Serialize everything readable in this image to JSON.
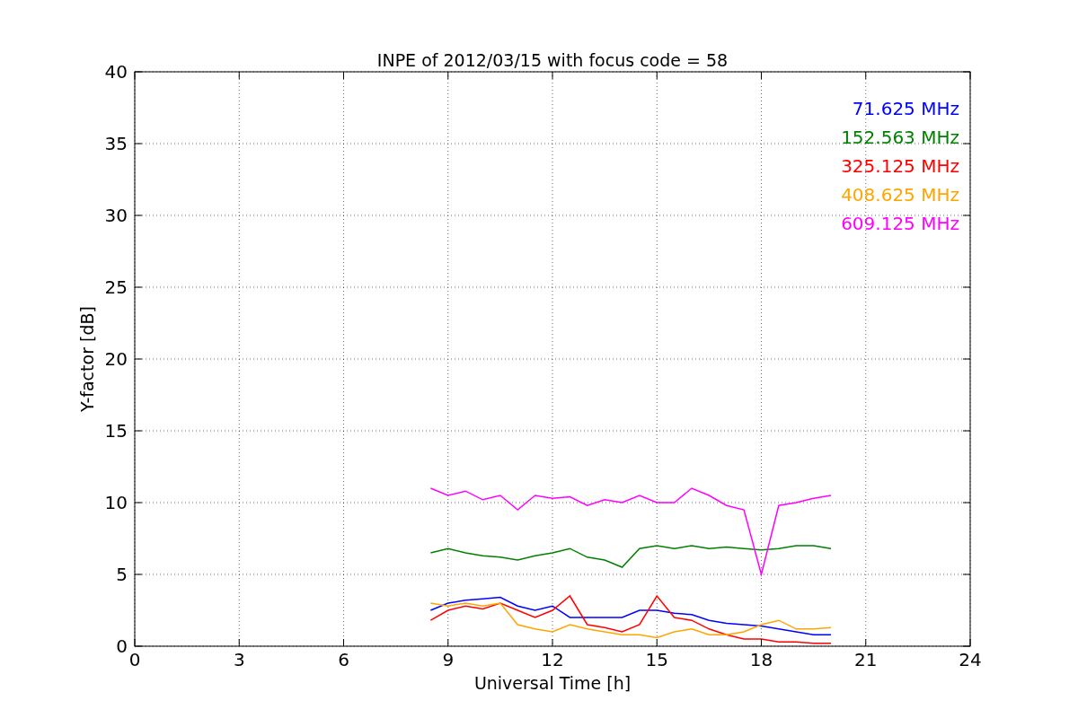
{
  "chart_data": {
    "type": "line",
    "title": "INPE of 2012/03/15 with focus code = 58",
    "xlabel": "Universal Time [h]",
    "ylabel": "Y-factor [dB]",
    "x": [
      8.5,
      9,
      9.5,
      10,
      10.5,
      11,
      11.5,
      12,
      12.5,
      13,
      13.5,
      14,
      14.5,
      15,
      15.5,
      16,
      16.5,
      17,
      17.5,
      18,
      18.5,
      19,
      19.5,
      20
    ],
    "series": [
      {
        "name": "71.625 MHz",
        "color": "#0000ff",
        "values": [
          2.5,
          3.0,
          3.2,
          3.3,
          3.4,
          2.8,
          2.5,
          2.8,
          2.0,
          2.0,
          2.0,
          2.0,
          2.5,
          2.5,
          2.3,
          2.2,
          1.8,
          1.6,
          1.5,
          1.4,
          1.2,
          1.0,
          0.8,
          0.8
        ]
      },
      {
        "name": "152.563 MHz",
        "color": "#008000",
        "values": [
          6.5,
          6.8,
          6.5,
          6.3,
          6.2,
          6.0,
          6.3,
          6.5,
          6.8,
          6.2,
          6.0,
          5.5,
          6.8,
          7.0,
          6.8,
          7.0,
          6.8,
          6.9,
          6.8,
          6.7,
          6.8,
          7.0,
          7.0,
          6.8
        ]
      },
      {
        "name": "325.125 MHz",
        "color": "#ff0000",
        "values": [
          1.8,
          2.5,
          2.8,
          2.6,
          3.0,
          2.5,
          2.0,
          2.5,
          3.5,
          1.5,
          1.3,
          1.0,
          1.5,
          3.5,
          2.0,
          1.8,
          1.2,
          0.8,
          0.5,
          0.5,
          0.3,
          0.3,
          0.2,
          0.2
        ]
      },
      {
        "name": "408.625 MHz",
        "color": "#ffa500",
        "values": [
          3.0,
          2.8,
          3.0,
          2.8,
          3.0,
          1.5,
          1.2,
          1.0,
          1.5,
          1.2,
          1.0,
          0.8,
          0.8,
          0.6,
          1.0,
          1.2,
          0.8,
          0.8,
          1.0,
          1.5,
          1.8,
          1.2,
          1.2,
          1.3
        ]
      },
      {
        "name": "609.125 MHz",
        "color": "#ff00ff",
        "values": [
          11,
          10.5,
          10.8,
          10.2,
          10.5,
          9.5,
          10.5,
          10.3,
          10.4,
          9.8,
          10.2,
          10,
          10.5,
          10,
          10,
          11,
          10.5,
          9.8,
          9.5,
          5,
          9.8,
          10,
          10.3,
          10.5
        ]
      }
    ],
    "xlim": [
      0,
      24
    ],
    "ylim": [
      0,
      40
    ],
    "xticks": [
      0,
      3,
      6,
      9,
      12,
      15,
      18,
      21,
      24
    ],
    "yticks": [
      0,
      5,
      10,
      15,
      20,
      25,
      30,
      35,
      40
    ],
    "grid": true
  }
}
